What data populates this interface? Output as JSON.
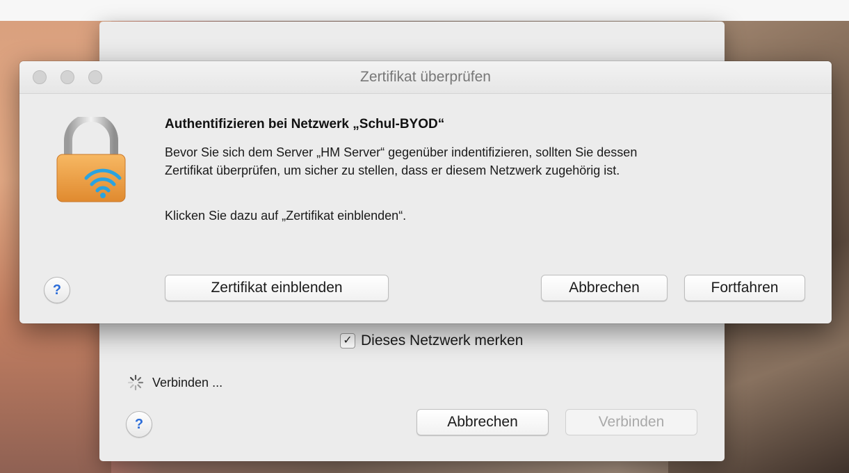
{
  "back_window": {
    "remember_label": "Dieses Netzwerk merken",
    "remember_checked": true,
    "status_text": "Verbinden ...",
    "help_label": "?",
    "cancel_label": "Abbrechen",
    "connect_label": "Verbinden",
    "connect_enabled": false
  },
  "dialog": {
    "title": "Zertifikat überprüfen",
    "heading": "Authentifizieren bei Netzwerk „Schul-BYOD“",
    "body_line1": "Bevor Sie sich dem Server „HM Server“ gegenüber indentifizieren, sollten Sie dessen",
    "body_line2": "Zertifikat überprüfen, um sicher zu stellen, dass er diesem Netzwerk zugehörig ist.",
    "hint": "Klicken Sie dazu auf „Zertifikat einblenden“.",
    "help_label": "?",
    "show_certificate_label": "Zertifikat einblenden",
    "cancel_label": "Abbrechen",
    "continue_label": "Fortfahren",
    "icon": "wifi-lock-icon"
  },
  "colors": {
    "dialog_bg": "#ececec",
    "lock_orange": "#f0a24a",
    "wifi_blue": "#2aa3e0",
    "help_blue": "#2b6cd8"
  }
}
